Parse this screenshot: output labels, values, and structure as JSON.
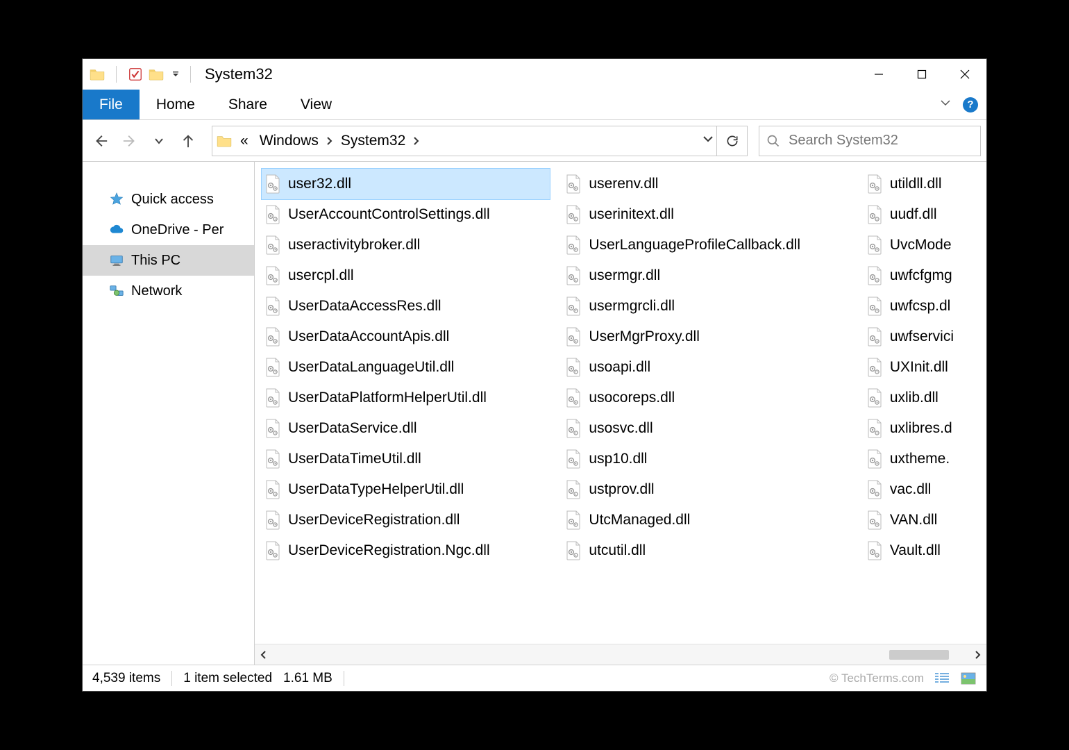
{
  "window": {
    "title": "System32"
  },
  "ribbon": {
    "file": "File",
    "home": "Home",
    "share": "Share",
    "view": "View"
  },
  "breadcrumb": {
    "prefix": "«",
    "parts": [
      "Windows",
      "System32"
    ]
  },
  "search": {
    "placeholder": "Search System32"
  },
  "sidebar": {
    "items": [
      {
        "label": "Quick access",
        "icon": "star"
      },
      {
        "label": "OneDrive - Per",
        "icon": "onedrive"
      },
      {
        "label": "This PC",
        "icon": "pc",
        "selected": true
      },
      {
        "label": "Network",
        "icon": "network"
      }
    ]
  },
  "files": {
    "col1": [
      {
        "name": "user32.dll",
        "selected": true
      },
      {
        "name": "UserAccountControlSettings.dll"
      },
      {
        "name": "useractivitybroker.dll"
      },
      {
        "name": "usercpl.dll"
      },
      {
        "name": "UserDataAccessRes.dll"
      },
      {
        "name": "UserDataAccountApis.dll"
      },
      {
        "name": "UserDataLanguageUtil.dll"
      },
      {
        "name": "UserDataPlatformHelperUtil.dll"
      },
      {
        "name": "UserDataService.dll"
      },
      {
        "name": "UserDataTimeUtil.dll"
      },
      {
        "name": "UserDataTypeHelperUtil.dll"
      },
      {
        "name": "UserDeviceRegistration.dll"
      },
      {
        "name": "UserDeviceRegistration.Ngc.dll"
      }
    ],
    "col2": [
      {
        "name": "userenv.dll"
      },
      {
        "name": "userinitext.dll"
      },
      {
        "name": "UserLanguageProfileCallback.dll"
      },
      {
        "name": "usermgr.dll"
      },
      {
        "name": "usermgrcli.dll"
      },
      {
        "name": "UserMgrProxy.dll"
      },
      {
        "name": "usoapi.dll"
      },
      {
        "name": "usocoreps.dll"
      },
      {
        "name": "usosvc.dll"
      },
      {
        "name": "usp10.dll"
      },
      {
        "name": "ustprov.dll"
      },
      {
        "name": "UtcManaged.dll"
      },
      {
        "name": "utcutil.dll"
      }
    ],
    "col3": [
      {
        "name": "utildll.dll"
      },
      {
        "name": "uudf.dll"
      },
      {
        "name": "UvcMode"
      },
      {
        "name": "uwfcfgmg"
      },
      {
        "name": "uwfcsp.dl"
      },
      {
        "name": "uwfservici"
      },
      {
        "name": "UXInit.dll"
      },
      {
        "name": "uxlib.dll"
      },
      {
        "name": "uxlibres.d"
      },
      {
        "name": "uxtheme."
      },
      {
        "name": "vac.dll"
      },
      {
        "name": "VAN.dll"
      },
      {
        "name": "Vault.dll"
      }
    ]
  },
  "status": {
    "count": "4,539 items",
    "selection": "1 item selected",
    "size": "1.61 MB",
    "watermark": "© TechTerms.com"
  }
}
